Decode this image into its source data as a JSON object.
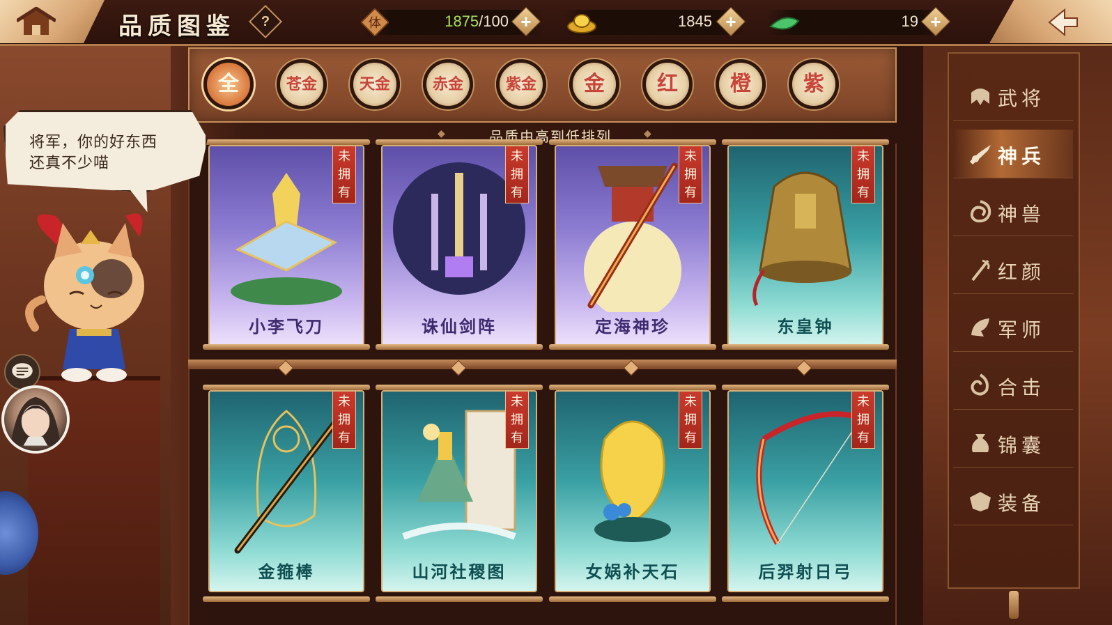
{
  "header": {
    "title": "品质图鉴",
    "help_label": "?",
    "stamina": {
      "current": "1875",
      "max": "/100",
      "icon": "stamina-icon",
      "badge": "体"
    },
    "gold": {
      "value": "1845",
      "icon": "gold-ingot-icon"
    },
    "jade": {
      "value": "19",
      "icon": "jade-icon"
    },
    "plus_label": "+"
  },
  "filters": [
    {
      "label": "全",
      "active": true
    },
    {
      "label": "苍金",
      "active": false
    },
    {
      "label": "天金",
      "active": false
    },
    {
      "label": "赤金",
      "active": false
    },
    {
      "label": "紫金",
      "active": false
    },
    {
      "label": "金",
      "active": false
    },
    {
      "label": "红",
      "active": false
    },
    {
      "label": "橙",
      "active": false
    },
    {
      "label": "紫",
      "active": false
    }
  ],
  "sort_label": "品质由高到低排列",
  "cards": [
    {
      "name": "小李飞刀",
      "status": "未拥有",
      "theme": "purple"
    },
    {
      "name": "诛仙剑阵",
      "status": "未拥有",
      "theme": "purple"
    },
    {
      "name": "定海神珍",
      "status": "未拥有",
      "theme": "purple"
    },
    {
      "name": "东皇钟",
      "status": "未拥有",
      "theme": "teal"
    },
    {
      "name": "金箍棒",
      "status": "未拥有",
      "theme": "teal"
    },
    {
      "name": "山河社稷图",
      "status": "未拥有",
      "theme": "teal"
    },
    {
      "name": "女娲补天石",
      "status": "未拥有",
      "theme": "teal"
    },
    {
      "name": "后羿射日弓",
      "status": "未拥有",
      "theme": "teal"
    }
  ],
  "side_menu": [
    {
      "label": "武将",
      "icon": "general-icon",
      "active": false
    },
    {
      "label": "神兵",
      "icon": "divine-weapon-icon",
      "active": true
    },
    {
      "label": "神兽",
      "icon": "divine-beast-icon",
      "active": false
    },
    {
      "label": "红颜",
      "icon": "beauty-icon",
      "active": false
    },
    {
      "label": "军师",
      "icon": "strategist-icon",
      "active": false
    },
    {
      "label": "合击",
      "icon": "combo-attack-icon",
      "active": false
    },
    {
      "label": "锦囊",
      "icon": "tactics-bag-icon",
      "active": false
    },
    {
      "label": "装备",
      "icon": "equipment-icon",
      "active": false
    }
  ],
  "speech": {
    "line1": "将军，你的好东西",
    "line2": "还真不少喵"
  },
  "colors": {
    "accent": "#c93a2c",
    "gold_border": "#d6b178",
    "stamina_green": "#a6e35b"
  }
}
